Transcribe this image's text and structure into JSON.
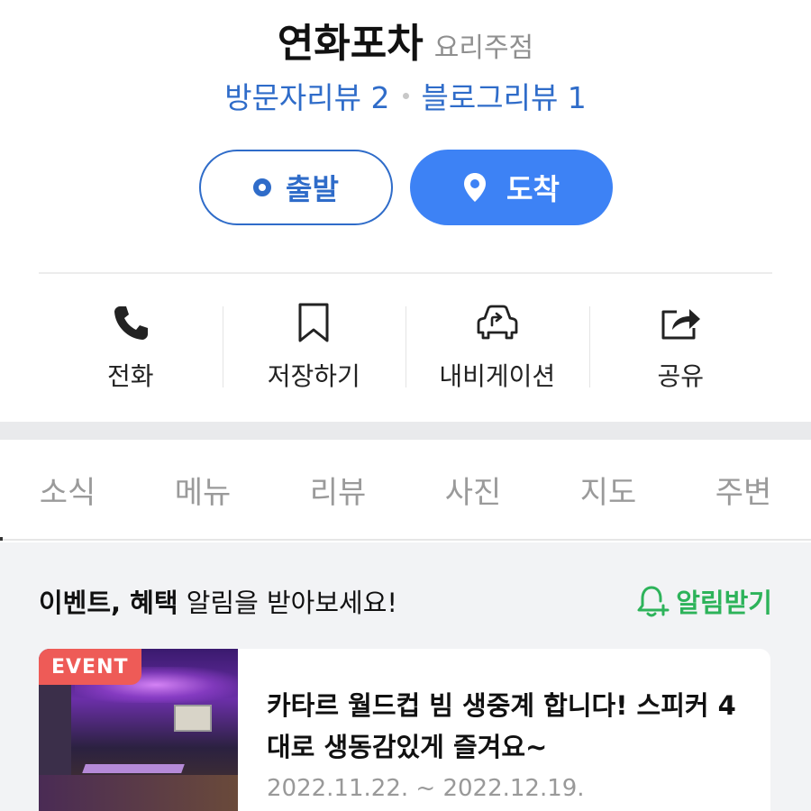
{
  "place": {
    "name": "연화포차",
    "category": "요리주점"
  },
  "reviews": {
    "visitor_label": "방문자리뷰 2",
    "blog_label": "블로그리뷰 1"
  },
  "route": {
    "depart_label": "출발",
    "arrive_label": "도착",
    "arrive_color": "#3d82f5",
    "accent_color": "#2f6cc9"
  },
  "actions": [
    {
      "label": "전화",
      "icon": "phone-icon"
    },
    {
      "label": "저장하기",
      "icon": "bookmark-icon"
    },
    {
      "label": "내비게이션",
      "icon": "car-navigation-icon"
    },
    {
      "label": "공유",
      "icon": "share-icon"
    }
  ],
  "tabs": [
    "소식",
    "메뉴",
    "리뷰",
    "사진",
    "지도",
    "주변"
  ],
  "event_section": {
    "heading_bold": "이벤트, 혜택",
    "heading_rest": " 알림을 받아보세요!",
    "notify_label": "알림받기",
    "notify_color": "#2db35a"
  },
  "event_card": {
    "badge": "EVENT",
    "badge_color": "#ee5b57",
    "title": "카타르 월드컵 빔 생중계 합니다! 스피커 4대로 생동감있게 즐겨요~",
    "date": "2022.11.22. ~ 2022.12.19."
  }
}
